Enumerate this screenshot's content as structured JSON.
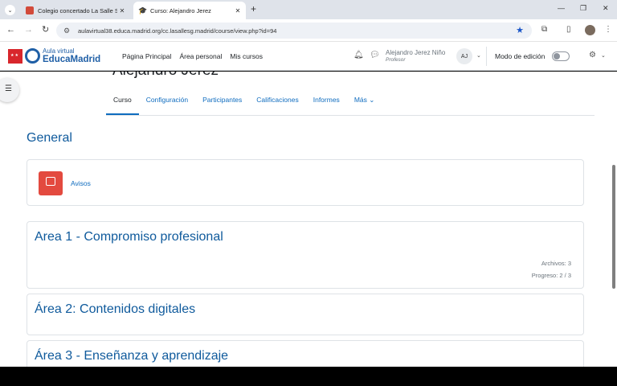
{
  "browser": {
    "tabs": [
      {
        "title": "Colegio concertado La Salle San",
        "active": false
      },
      {
        "title": "Curso: Alejandro Jerez",
        "active": true
      }
    ],
    "url": "aulavirtual38.educa.madrid.org/cc.lasallesg.madrid/course/view.php?id=94"
  },
  "site": {
    "logo_small": "Aula virtual",
    "logo_big": "EducaMadrid",
    "nav": [
      "Página Principal",
      "Área personal",
      "Mis cursos"
    ],
    "user": {
      "name": "Alejandro Jerez Niño",
      "role": "Profesor",
      "initials": "AJ"
    },
    "edit_mode_label": "Modo de edición",
    "edit_mode_on": false
  },
  "course": {
    "title": "Alejandro Jerez",
    "tabs": [
      "Curso",
      "Configuración",
      "Participantes",
      "Calificaciones",
      "Informes",
      "Más"
    ],
    "active_tab": "Curso"
  },
  "sections": {
    "general": {
      "title": "General",
      "activity": "Avisos"
    },
    "area1": {
      "title": "Area 1 - Compromiso profesional",
      "files": "Archivos: 3",
      "progress": "Progreso: 2 / 3"
    },
    "area2": {
      "title": "Área 2: Contenidos digitales"
    },
    "area3": {
      "title": "Área 3 - Enseñanza y aprendizaje"
    }
  }
}
